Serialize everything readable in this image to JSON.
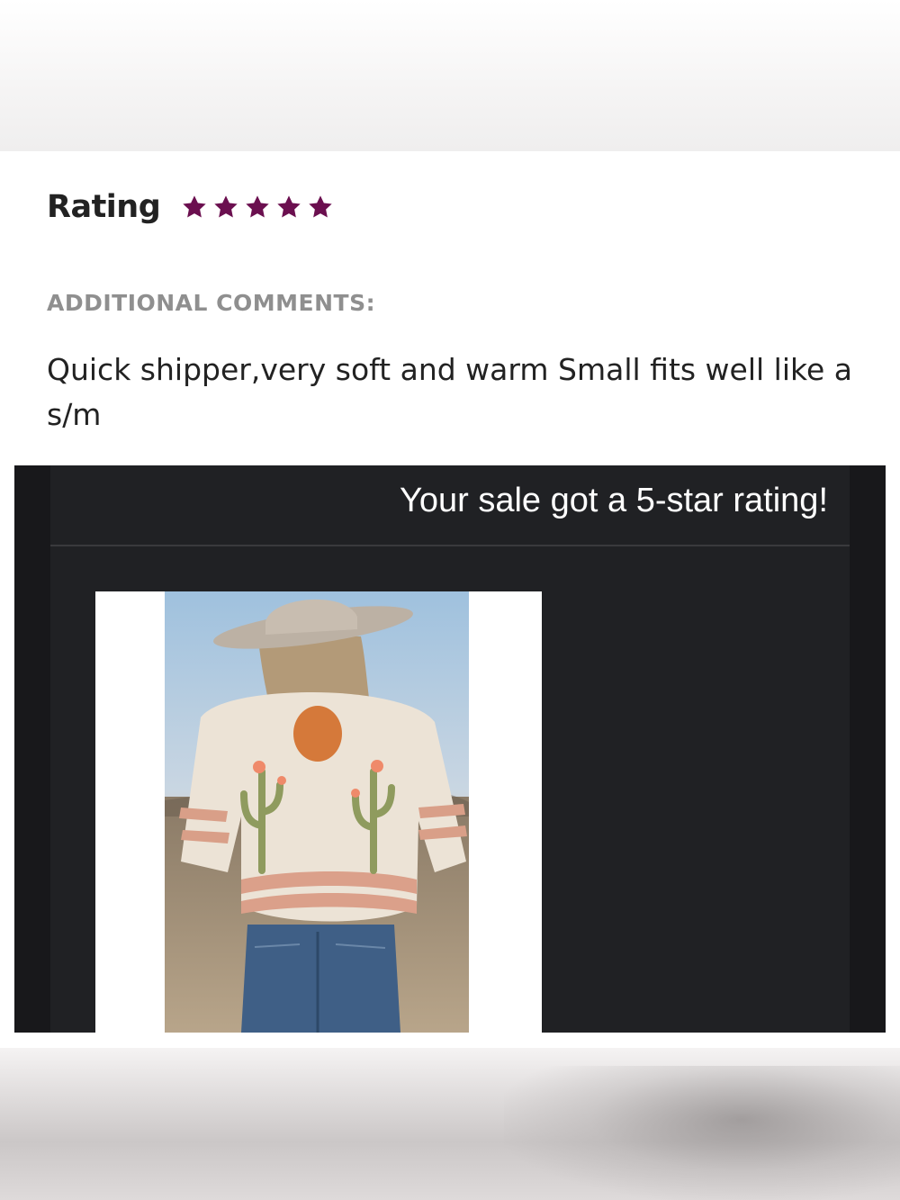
{
  "review": {
    "rating_label": "Rating",
    "stars": 5,
    "star_color": "#6b0f4f",
    "comments_heading": "ADDITIONAL COMMENTS:",
    "comment": "Quick shipper,very soft and warm Small fits well like a s/m"
  },
  "email": {
    "title": "Your sale got a 5-star rating!",
    "background_color": "#202124"
  },
  "product": {
    "image": "product-photo",
    "description": "woman in cowboy hat wearing cream sweater with cactus and sun design"
  }
}
